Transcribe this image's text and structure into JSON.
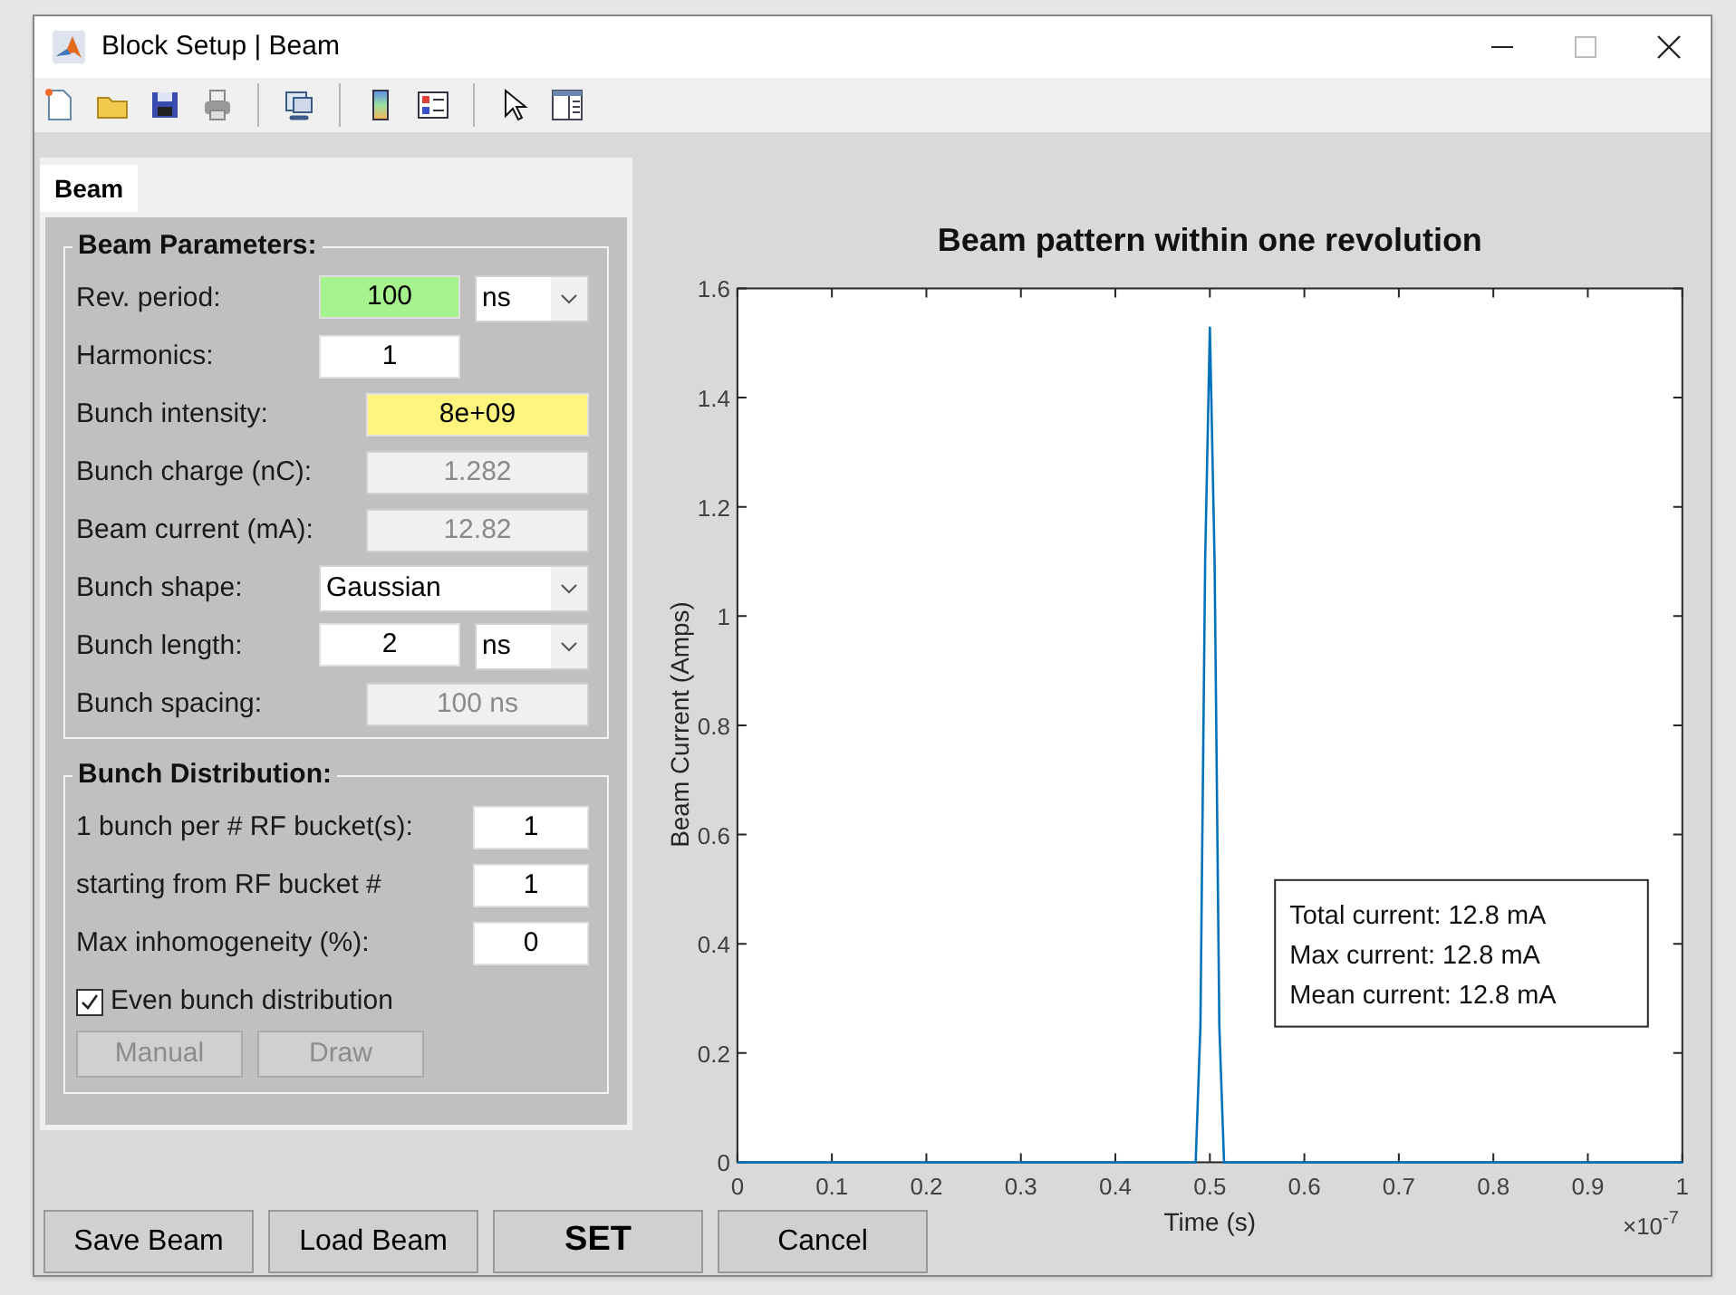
{
  "window": {
    "title": "Block Setup | Beam"
  },
  "tabs": [
    {
      "label": "Beam",
      "selected": true
    }
  ],
  "groups": [
    {
      "title": "Beam Parameters:",
      "rows": [
        {
          "label": "Rev. period:",
          "kind": "short-input",
          "value": "100",
          "color": "#a6f28c",
          "unit": "ns"
        },
        {
          "label": "Harmonics:",
          "kind": "short-input",
          "value": "1"
        },
        {
          "label": "Bunch intensity:",
          "kind": "input",
          "value": "8e+09",
          "color": "#fff47e"
        },
        {
          "label": "Bunch charge (nC):",
          "kind": "readonly",
          "value": "1.282"
        },
        {
          "label": "Beam current (mA):",
          "kind": "readonly",
          "value": "12.82"
        },
        {
          "label": "Bunch shape:",
          "kind": "select",
          "value": "Gaussian"
        },
        {
          "label": "Bunch length:",
          "kind": "short-input",
          "value": "2",
          "unit": "ns"
        },
        {
          "label": "Bunch spacing:",
          "kind": "readonly",
          "value": "100 ns"
        }
      ]
    },
    {
      "title": "Bunch Distribution:",
      "rows": [
        {
          "label": "1 bunch per # RF bucket(s):",
          "kind": "small-input",
          "value": "1"
        },
        {
          "label": "starting from RF bucket #",
          "kind": "small-input",
          "value": "1"
        },
        {
          "label": "Max inhomogeneity (%):",
          "kind": "small-input",
          "value": "0"
        }
      ],
      "checkbox": {
        "label": "Even bunch distribution",
        "checked": true
      },
      "buttons": [
        {
          "label": "Manual",
          "disabled": true
        },
        {
          "label": "Draw",
          "disabled": true
        }
      ]
    }
  ],
  "footer_buttons": [
    {
      "label": "Save Beam",
      "kind": "normal"
    },
    {
      "label": "Load Beam",
      "kind": "normal"
    },
    {
      "label": "SET",
      "kind": "default"
    },
    {
      "label": "Cancel",
      "kind": "normal"
    }
  ],
  "plot": {
    "axis_multiplier": "×10$^{-7}$",
    "chart_data": {
      "type": "line",
      "title": "Beam pattern within one revolution",
      "xlabel": "Time (s)",
      "ylabel": "Beam Current (Amps)",
      "xlim": [
        0,
        1
      ],
      "ylim": [
        0,
        1.6
      ],
      "xticks": [
        0,
        {
          "value": 0.1,
          "label": "0.1"
        },
        {
          "value": 0.2,
          "label": "0.2"
        },
        {
          "value": 0.3,
          "label": "0.3"
        },
        {
          "value": 0.4,
          "label": "0.4"
        },
        {
          "value": 0.5,
          "label": "0.5"
        },
        {
          "value": 0.6,
          "label": "0.6"
        },
        {
          "value": 0.7,
          "label": "0.7"
        },
        {
          "value": 0.8,
          "label": "0.8"
        },
        {
          "value": 0.9,
          "label": "0.9"
        },
        1
      ],
      "yticks": [
        0,
        {
          "value": 0.2,
          "label": "0.2"
        },
        {
          "value": 0.4,
          "label": "0.4"
        },
        {
          "value": 0.6,
          "label": "0.6"
        },
        {
          "value": 0.8,
          "label": "0.8"
        },
        1,
        {
          "value": 1.2,
          "label": "1.2"
        },
        {
          "value": 1.4,
          "label": "1.4"
        },
        {
          "value": 1.6,
          "label": "1.6"
        }
      ],
      "x": [
        0,
        0.485,
        0.49,
        0.495,
        0.5,
        0.505,
        0.51,
        0.515,
        1
      ],
      "series": [
        {
          "color": "#0072bd",
          "values": [
            0,
            0,
            0.25,
            1.1,
            1.53,
            1.1,
            0.25,
            0,
            0
          ]
        }
      ],
      "annotations": [
        "Total current: 12.8 mA",
        "Max current: 12.8 mA",
        "Mean current: 12.8 mA"
      ]
    }
  }
}
